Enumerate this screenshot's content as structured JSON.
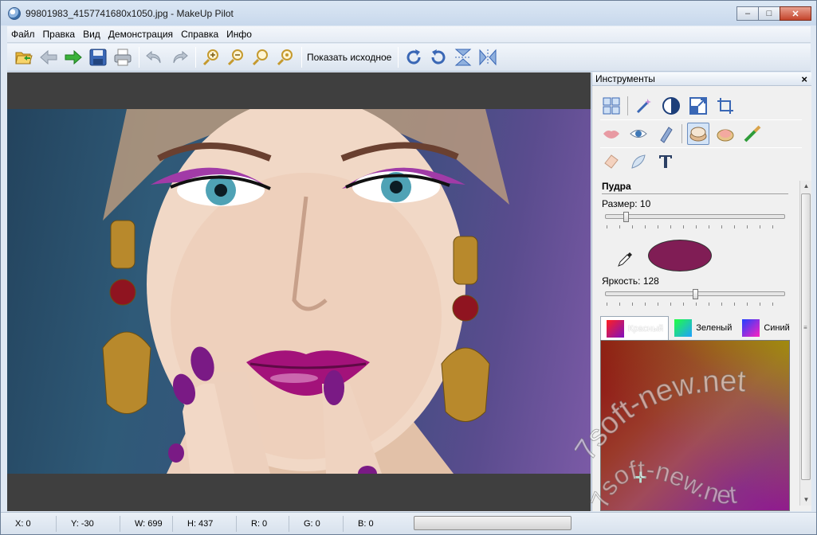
{
  "window": {
    "title": "99801983_4157741680x1050.jpg - MakeUp Pilot",
    "controls": {
      "minimize": "–",
      "maximize": "□",
      "close": "✕"
    }
  },
  "menu": {
    "items": [
      "Файл",
      "Правка",
      "Вид",
      "Демонстрация",
      "Справка",
      "Инфо"
    ]
  },
  "toolbar": {
    "show_original_label": "Показать исходное",
    "icons": [
      "open-folder-icon",
      "back-arrow-icon",
      "forward-arrow-icon",
      "save-icon",
      "print-icon",
      "undo-icon",
      "redo-icon",
      "zoom-in-icon",
      "zoom-out-icon",
      "zoom-fit-icon",
      "zoom-actual-icon",
      "rotate-right-icon",
      "rotate-left-icon",
      "flip-vertical-icon",
      "flip-horizontal-icon"
    ]
  },
  "panel": {
    "title": "Инструменты",
    "close": "×",
    "section": {
      "title": "Пудра",
      "size_label": "Размер: 10",
      "size_value": 10,
      "brightness_label": "Яркость: 128",
      "brightness_value": 128,
      "swatch_color": "#801d55",
      "tabs": [
        {
          "label": "Красный",
          "active": true
        },
        {
          "label": "Зеленый",
          "active": false
        },
        {
          "label": "Синий",
          "active": false
        }
      ]
    }
  },
  "watermark": {
    "text_top": "7soft-new.net",
    "text_bottom": "7soft-new.net"
  },
  "status": {
    "x": "X: 0",
    "y": "Y: -30",
    "w": "W: 699",
    "h": "H: 437",
    "r": "R: 0",
    "g": "G: 0",
    "b": "B: 0"
  }
}
